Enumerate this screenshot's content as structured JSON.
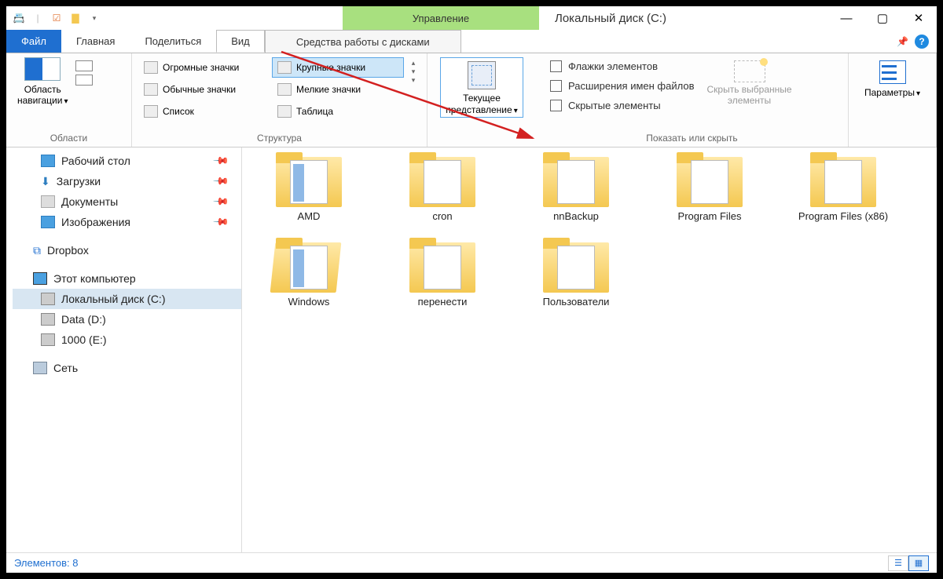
{
  "titlebar": {
    "context_tab": "Управление",
    "title": "Локальный диск (C:)"
  },
  "tabs": {
    "file": "Файл",
    "home": "Главная",
    "share": "Поделиться",
    "view": "Вид",
    "tools": "Средства работы с дисками"
  },
  "ribbon": {
    "panes_label": "Области",
    "navpane": "Область\nнавигации",
    "layout_label": "Структура",
    "layout": {
      "huge": "Огромные значки",
      "large": "Крупные значки",
      "normal": "Обычные значки",
      "small": "Мелкие значки",
      "list": "Список",
      "table": "Таблица"
    },
    "current_repr": "Текущее\nпредставление",
    "show_hide_label": "Показать или скрыть",
    "chk_boxes": "Флажки элементов",
    "chk_ext": "Расширения имен файлов",
    "chk_hidden": "Скрытые элементы",
    "hide_selected": "Скрыть выбранные\nэлементы",
    "options": "Параметры"
  },
  "sidebar": {
    "desktop": "Рабочий стол",
    "downloads": "Загрузки",
    "documents": "Документы",
    "pictures": "Изображения",
    "dropbox": "Dropbox",
    "thispc": "Этот компьютер",
    "cdrive": "Локальный диск (C:)",
    "ddrive": "Data (D:)",
    "edrive": "1000 (E:)",
    "network": "Сеть"
  },
  "folders": [
    "AMD",
    "cron",
    "nnBackup",
    "Program Files",
    "Program Files (x86)",
    "Windows",
    "перенести",
    "Пользователи"
  ],
  "status": {
    "count": "Элементов: 8"
  }
}
